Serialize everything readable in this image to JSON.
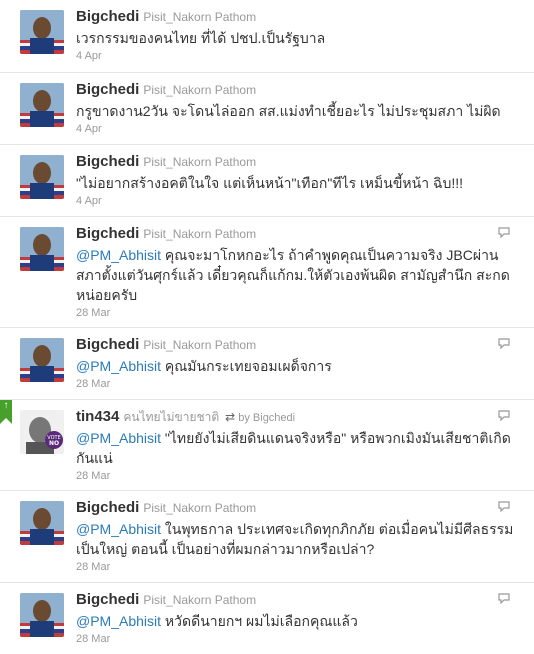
{
  "tweets": [
    {
      "name": "Bigchedi",
      "handle": "Pisit_Nakorn Pathom",
      "mention": "",
      "text": "เวรกรรมของคนไทย ที่ได้ ปชป.เป็นรัฐบาล",
      "date": "4 Apr"
    },
    {
      "name": "Bigchedi",
      "handle": "Pisit_Nakorn Pathom",
      "mention": "",
      "text": "กรูขาดงาน2วัน จะโดนไล่ออก สส.แม่งทำเชี้ยอะไร ไม่ประชุมสภา ไม่ผิด",
      "date": "4 Apr"
    },
    {
      "name": "Bigchedi",
      "handle": "Pisit_Nakorn Pathom",
      "mention": "",
      "text": "\"ไม่อยากสร้างอคติในใจ แต่เห็นหน้า\"เทือก\"ทีไร เหม็นขี้หน้า ฉิบ!!!",
      "date": "4 Apr"
    },
    {
      "name": "Bigchedi",
      "handle": "Pisit_Nakorn Pathom",
      "mention": "@PM_Abhisit",
      "text": " คุณจะมาโกหกอะไร ถ้าคำพูดคุณเป็นความจริง JBCผ่านสภาตั้งแต่วันศุกร์แล้ว เดี๋ยวคุณก็แก้กม.ให้ตัวเองพ้นผิด สามัญสำนึก สะกดหน่อยครับ",
      "date": "28 Mar"
    },
    {
      "name": "Bigchedi",
      "handle": "Pisit_Nakorn Pathom",
      "mention": "@PM_Abhisit",
      "text": " คุณมันกระเทยจอมเผด็จการ",
      "date": "28 Mar"
    },
    {
      "name": "tin434",
      "handle": "คนไทยไม่ขายชาติ",
      "retweet_by": "by Bigchedi",
      "mention": "@PM_Abhisit",
      "text": " \"ไทยยังไม่เสียดินแดนจริงหรือ\" หรือพวกเมิงมันเสียชาติเกิดกันแน่",
      "date": "28 Mar"
    },
    {
      "name": "Bigchedi",
      "handle": "Pisit_Nakorn Pathom",
      "mention": "@PM_Abhisit",
      "text": " ในพุทธกาล ประเทศจะเกิดทุกภิกภัย ต่อเมื่อคนไม่มีศีลธรรมเป็นใหญ่ ตอนนี้ เป็นอย่างที่ผมกล่าวมากหรือเปล่า?",
      "date": "28 Mar"
    },
    {
      "name": "Bigchedi",
      "handle": "Pisit_Nakorn Pathom",
      "mention": "@PM_Abhisit",
      "text": " หวัดดีนายกฯ ผมไม่เลือกคุณแล้ว",
      "date": "28 Mar"
    }
  ],
  "avatar_badge_text": [
    "VOTE",
    "NO"
  ],
  "colors": {
    "mention": "#2b7bb9",
    "retweet_flag": "#46a02a"
  }
}
